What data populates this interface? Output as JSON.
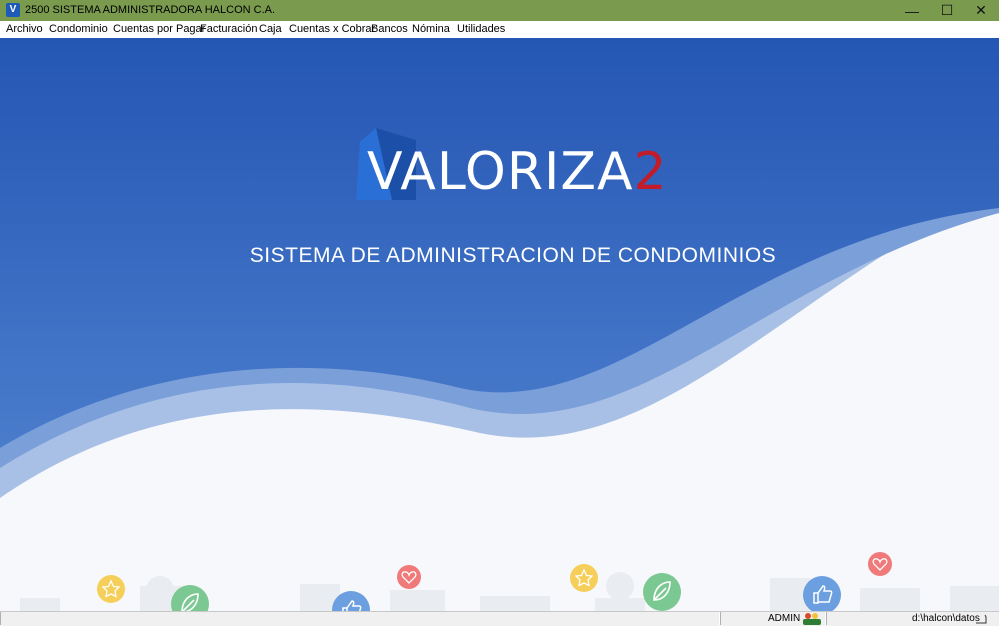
{
  "window": {
    "title": "2500  SISTEMA ADMINISTRADORA HALCON C.A.",
    "app_icon_letter": "V",
    "minimize_glyph": "—",
    "maximize_glyph": "☐",
    "close_glyph": "✕"
  },
  "menu": {
    "items": [
      "Archivo",
      "Condominio",
      "Cuentas por Pagar",
      "Facturación",
      "Caja",
      "Cuentas x Cobrar",
      "Bancos",
      "Nómina",
      "Utilidades"
    ]
  },
  "splash": {
    "logo_main": "VALORIZA",
    "logo_accent": "2",
    "subtitle": "SISTEMA DE ADMINISTRACION DE CONDOMINIOS"
  },
  "statusbar": {
    "user": "ADMIN",
    "path": "d:\\halcon\\datos"
  },
  "colors": {
    "titlebar": "#7a9a4e",
    "banner_blue": "#2f62bf",
    "logo_red": "#c21c2a"
  },
  "icons": [
    "star-icon",
    "leaf-icon",
    "thumbs-up-icon",
    "heart-icon"
  ]
}
